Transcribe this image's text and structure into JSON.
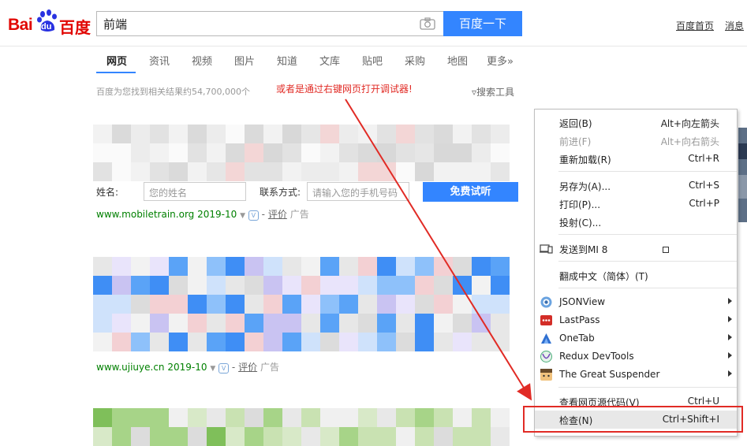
{
  "header": {
    "logo": {
      "bai": "Bai",
      "du": "du",
      "text": "百度"
    },
    "search": {
      "value": "前端"
    },
    "search_button": "百度一下",
    "links": [
      "百度首页",
      "消息"
    ]
  },
  "tabs": {
    "items": [
      "网页",
      "资讯",
      "视频",
      "图片",
      "知道",
      "文库",
      "贴吧",
      "采购",
      "地图",
      "更多»"
    ],
    "active": 0
  },
  "results": {
    "count_text": "百度为您找到相关结果约54,700,000个",
    "annotation": "或者是通过右键网页打开调试器!",
    "tools_label": "搜索工具",
    "form": {
      "name_label": "姓名:",
      "name_placeholder": "您的姓名",
      "contact_label": "联系方式:",
      "contact_placeholder": "请输入您的手机号码",
      "submit": "免费试听"
    },
    "items": [
      {
        "url": "www.mobiletrain.org",
        "date": "2019-10",
        "review": "评价",
        "ad": "广告"
      },
      {
        "url": "www.ujiuye.cn",
        "date": "2019-10",
        "review": "评价",
        "ad": "广告"
      }
    ]
  },
  "context_menu": {
    "items": [
      {
        "label": "返回(B)",
        "shortcut": "Alt+向左箭头"
      },
      {
        "label": "前进(F)",
        "shortcut": "Alt+向右箭头"
      },
      {
        "label": "重新加载(R)",
        "shortcut": "Ctrl+R"
      },
      {
        "label": "另存为(A)...",
        "shortcut": "Ctrl+S"
      },
      {
        "label": "打印(P)...",
        "shortcut": "Ctrl+P"
      },
      {
        "label": "投射(C)...",
        "shortcut": ""
      },
      {
        "label": "发送到MI 8",
        "shortcut": ""
      },
      {
        "label": "翻成中文（简体）(T)",
        "shortcut": ""
      },
      {
        "label": "JSONView",
        "shortcut": ""
      },
      {
        "label": "LastPass",
        "shortcut": ""
      },
      {
        "label": "OneTab",
        "shortcut": ""
      },
      {
        "label": "Redux DevTools",
        "shortcut": ""
      },
      {
        "label": "The Great Suspender",
        "shortcut": ""
      },
      {
        "label": "查看网页源代码(V)",
        "shortcut": "Ctrl+U"
      },
      {
        "label": "检查(N)",
        "shortcut": "Ctrl+Shift+I"
      }
    ]
  },
  "colors": {
    "brand_red": "#e10602",
    "brand_blue": "#3385ff",
    "annotation_red": "#e12b25",
    "url_green": "#008000"
  }
}
